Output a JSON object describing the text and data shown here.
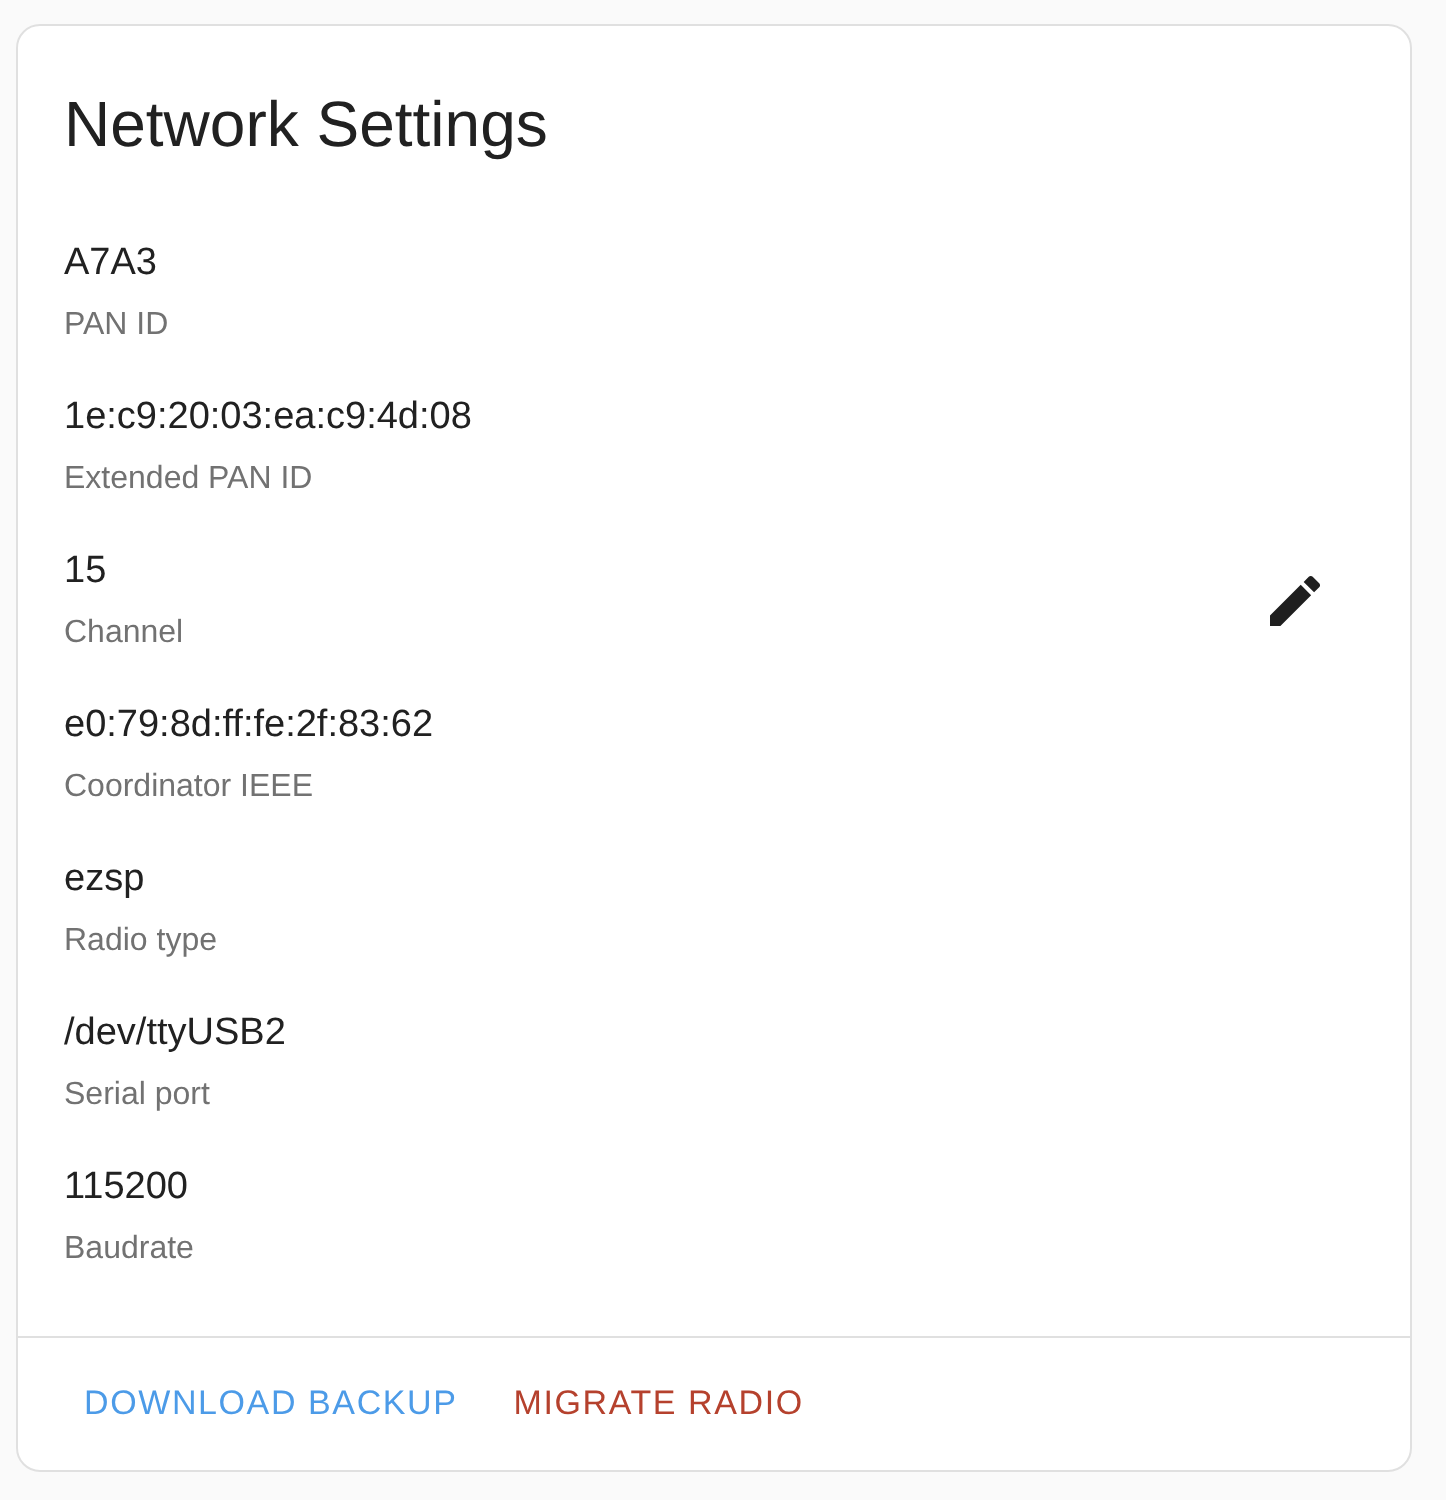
{
  "card": {
    "title": "Network Settings",
    "fields": [
      {
        "value": "A7A3",
        "label": "PAN ID",
        "editable": false
      },
      {
        "value": "1e:c9:20:03:ea:c9:4d:08",
        "label": "Extended PAN ID",
        "editable": false
      },
      {
        "value": "15",
        "label": "Channel",
        "editable": true
      },
      {
        "value": "e0:79:8d:ff:fe:2f:83:62",
        "label": "Coordinator IEEE",
        "editable": false
      },
      {
        "value": "ezsp",
        "label": "Radio type",
        "editable": false
      },
      {
        "value": "/dev/ttyUSB2",
        "label": "Serial port",
        "editable": false
      },
      {
        "value": "115200",
        "label": "Baudrate",
        "editable": false
      }
    ],
    "actions": [
      {
        "label": "DOWNLOAD BACKUP",
        "color": "#4c9be8"
      },
      {
        "label": "MIGRATE RADIO",
        "color": "#b5412d"
      }
    ]
  }
}
